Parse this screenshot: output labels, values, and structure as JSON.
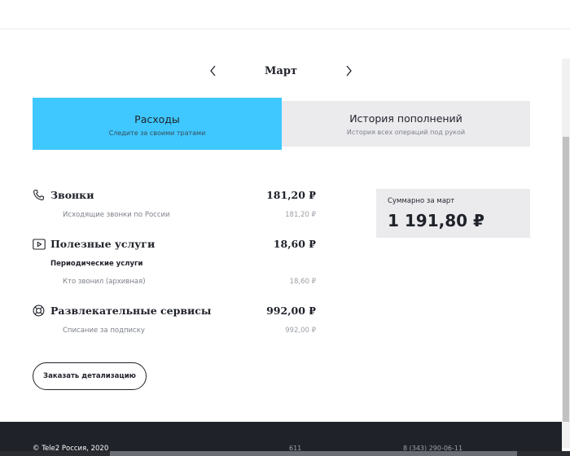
{
  "month_nav": {
    "month": "Март",
    "prev_icon": "chevron-left-icon",
    "next_icon": "chevron-right-icon"
  },
  "tabs": [
    {
      "title": "Расходы",
      "subtitle": "Следите за своими тратами",
      "active": true
    },
    {
      "title": "История пополнений",
      "subtitle": "История всех операций под рукой",
      "active": false
    }
  ],
  "categories": [
    {
      "icon": "phone-icon",
      "title": "Звонки",
      "amount": "181,20 ₽",
      "items": [
        {
          "label": "Исходящие звонки по России",
          "amount": "181,20 ₽"
        }
      ]
    },
    {
      "icon": "play-icon",
      "title": "Полезные услуги",
      "amount": "18,60 ₽",
      "subheader": "Периодические услуги",
      "items": [
        {
          "label": "Кто звонил (архивная)",
          "amount": "18,60 ₽"
        }
      ]
    },
    {
      "icon": "lifebuoy-icon",
      "title": "Развлекательные сервисы",
      "amount": "992,00 ₽",
      "items": [
        {
          "label": "Списание за подписку",
          "amount": "992,00 ₽"
        }
      ]
    }
  ],
  "summary": {
    "label": "Суммарно за март",
    "value": "1 191,80 ₽"
  },
  "order_button": "Заказать детализацию",
  "footer": {
    "copyright": "© Tele2 Россия, 2020",
    "short_number": "611",
    "phone": "8 (343) 290-06-11"
  },
  "colors": {
    "accent": "#3fc8ff",
    "footer_bg": "#1f2229",
    "panel_bg": "#ebebee"
  }
}
